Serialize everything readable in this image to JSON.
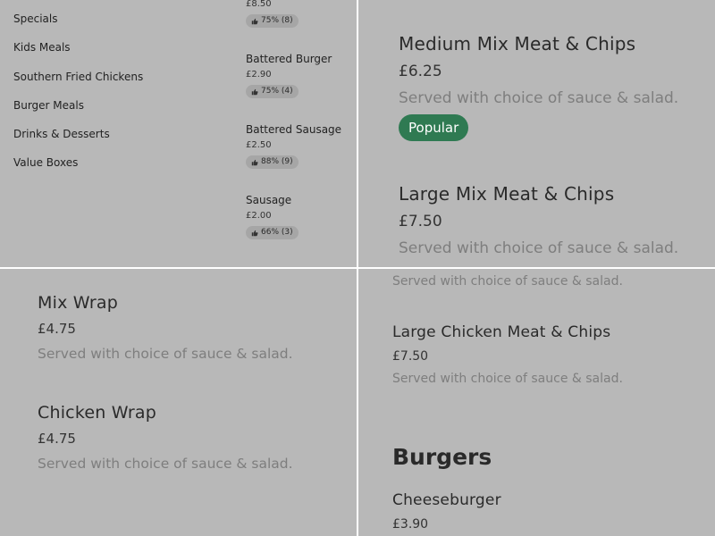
{
  "panel1": {
    "categories": [
      "Specials",
      "Kids Meals",
      "Southern Fried Chickens",
      "Burger Meals",
      "Drinks & Desserts",
      "Value Boxes"
    ],
    "top_item": {
      "price": "£8.50",
      "rating": "75% (8)"
    },
    "items": [
      {
        "name": "Battered Burger",
        "price": "£2.90",
        "rating": "75% (4)"
      },
      {
        "name": "Battered Sausage",
        "price": "£2.50",
        "rating": "88% (9)"
      },
      {
        "name": "Sausage",
        "price": "£2.00",
        "rating": "66% (3)"
      }
    ]
  },
  "panel2": {
    "items": [
      {
        "title": "Medium Mix Meat & Chips",
        "price": "£6.25",
        "desc": "Served with choice of sauce & salad.",
        "badge": "Popular"
      },
      {
        "title": "Large Mix Meat & Chips",
        "price": "£7.50",
        "desc": "Served with choice of sauce & salad."
      }
    ]
  },
  "panel3": {
    "items": [
      {
        "title": "Mix Wrap",
        "price": "£4.75",
        "desc": "Served with choice of sauce & salad."
      },
      {
        "title": "Chicken Wrap",
        "price": "£4.75",
        "desc": "Served with choice of sauce & salad."
      }
    ]
  },
  "panel4": {
    "partial_desc": "Served with choice of sauce & salad.",
    "items": [
      {
        "title": "Large Chicken Meat & Chips",
        "price": "£7.50",
        "desc": "Served with choice of sauce & salad."
      }
    ],
    "section_heading": "Burgers",
    "section_items": [
      {
        "title": "Cheeseburger",
        "price": "£3.90"
      }
    ]
  },
  "colors": {
    "panel_bg": "#b8b8b8",
    "popular_badge": "#2f7a52",
    "description_text": "#7e7e7e"
  },
  "icons": {
    "rating": "thumbs-up-icon"
  }
}
